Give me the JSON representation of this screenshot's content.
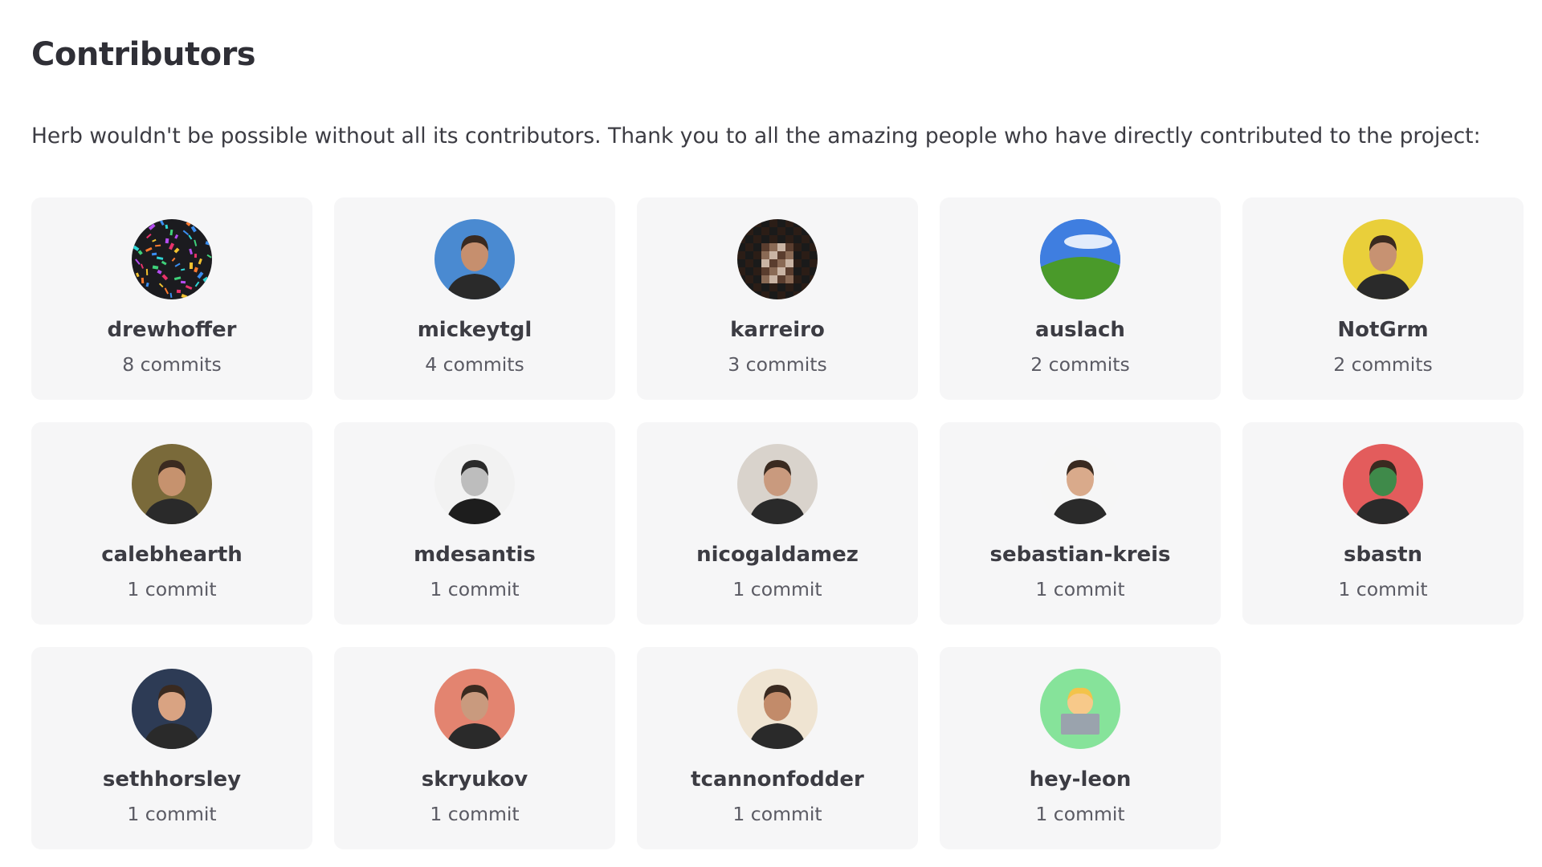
{
  "heading": "Contributors",
  "intro": "Herb wouldn't be possible without all its contributors. Thank you to all the amazing people who have directly contributed to the project:",
  "contributors": [
    {
      "name": "drewhoffer",
      "commits": "8 commits",
      "avatar": "confetti",
      "bg": "#1b1b1f",
      "accent": "#e8336b"
    },
    {
      "name": "mickeytgl",
      "commits": "4 commits",
      "avatar": "person",
      "bg": "#4a8ad1",
      "accent": "#c68f6e"
    },
    {
      "name": "karreiro",
      "commits": "3 commits",
      "avatar": "pixelated",
      "bg": "#e9e6e2",
      "accent": "#5a3d2e"
    },
    {
      "name": "auslach",
      "commits": "2 commits",
      "avatar": "landscape",
      "bg": "#3f7ee0",
      "accent": "#4a9a2a"
    },
    {
      "name": "NotGrm",
      "commits": "2 commits",
      "avatar": "person",
      "bg": "#e9cf3a",
      "accent": "#c79272"
    },
    {
      "name": "calebhearth",
      "commits": "1 commit",
      "avatar": "person",
      "bg": "#7a6a3a",
      "accent": "#c6926e"
    },
    {
      "name": "mdesantis",
      "commits": "1 commit",
      "avatar": "person-bw",
      "bg": "#f2f2f2",
      "accent": "#bdbdbd"
    },
    {
      "name": "nicogaldamez",
      "commits": "1 commit",
      "avatar": "person",
      "bg": "#d9d3cc",
      "accent": "#c99a7e"
    },
    {
      "name": "sebastian-kreis",
      "commits": "1 commit",
      "avatar": "person",
      "bg": "#f6f6f6",
      "accent": "#d9aa8b"
    },
    {
      "name": "sbastn",
      "commits": "1 commit",
      "avatar": "person",
      "bg": "#e35c5c",
      "accent": "#3f8a4a"
    },
    {
      "name": "sethhorsley",
      "commits": "1 commit",
      "avatar": "person",
      "bg": "#2d3b55",
      "accent": "#d9a382"
    },
    {
      "name": "skryukov",
      "commits": "1 commit",
      "avatar": "person",
      "bg": "#e38470",
      "accent": "#c99a7e"
    },
    {
      "name": "tcannonfodder",
      "commits": "1 commit",
      "avatar": "person",
      "bg": "#efe4d2",
      "accent": "#c28b6a"
    },
    {
      "name": "hey-leon",
      "commits": "1 commit",
      "avatar": "emoji-technologist",
      "bg": "#86e39a",
      "accent": "#f3c34a"
    }
  ]
}
